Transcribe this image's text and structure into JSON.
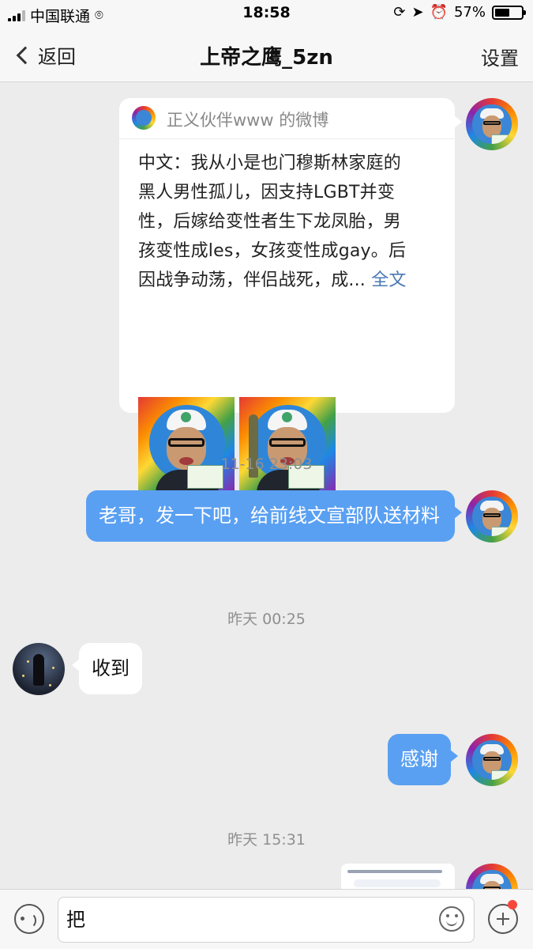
{
  "status_bar": {
    "carrier": "中国联通",
    "time": "18:58",
    "battery_percent": "57%",
    "battery_level": 0.57
  },
  "nav": {
    "back_label": "返回",
    "title": "上帝之鹰_5zn",
    "settings_label": "设置"
  },
  "messages": {
    "shared_card": {
      "source": "正义伙伴www 的微博",
      "lines": [
        "中文：我从小是也门穆斯林家庭的",
        "黑人男性孤儿，因支持LGBT并变",
        "性，后嫁给变性者生下龙凤胎，男",
        "孩变性成les，女孩变性成gay。后"
      ],
      "last_line": "因战争动荡，伴侣战死，成...",
      "more_label": "全文"
    },
    "ts1": "11-16 23:03",
    "msg1": "老哥，发一下吧，给前线文宣部队送材料",
    "ts2": "昨天 00:25",
    "msg2": "收到",
    "msg3": "感谢",
    "ts3": "昨天 15:31"
  },
  "input_bar": {
    "text": "把"
  }
}
